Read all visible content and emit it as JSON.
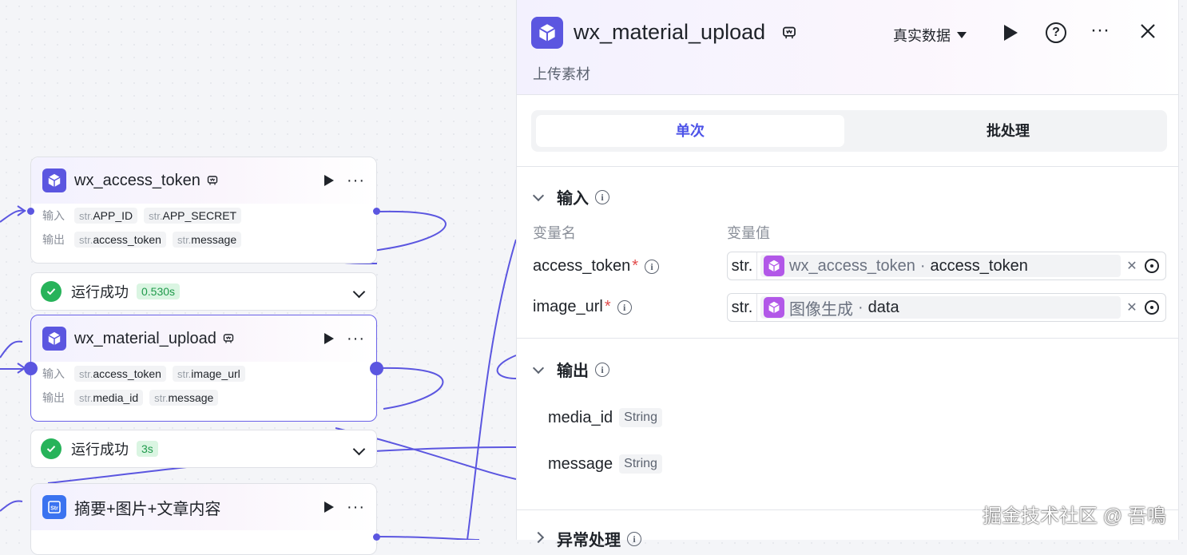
{
  "canvas": {
    "nodes": [
      {
        "title": "wx_access_token",
        "icon": "plugin-cube-icon",
        "inputs_label": "输入",
        "outputs_label": "输出",
        "inputs": [
          {
            "type": "str.",
            "name": "APP_ID"
          },
          {
            "type": "str.",
            "name": "APP_SECRET"
          }
        ],
        "outputs": [
          {
            "type": "str.",
            "name": "access_token"
          },
          {
            "type": "str.",
            "name": "message"
          }
        ],
        "status": {
          "text": "运行成功",
          "time": "0.530s"
        }
      },
      {
        "title": "wx_material_upload",
        "icon": "plugin-cube-icon",
        "inputs_label": "输入",
        "outputs_label": "输出",
        "inputs": [
          {
            "type": "str.",
            "name": "access_token"
          },
          {
            "type": "str.",
            "name": "image_url"
          }
        ],
        "outputs": [
          {
            "type": "str.",
            "name": "media_id"
          },
          {
            "type": "str.",
            "name": "message"
          }
        ],
        "status": {
          "text": "运行成功",
          "time": "3s"
        }
      },
      {
        "title": "摘要+图片+文章内容",
        "icon": "text-str-icon"
      }
    ]
  },
  "panel": {
    "title": "wx_material_upload",
    "subtitle": "上传素材",
    "mode": "真实数据",
    "tabs": [
      {
        "label": "单次"
      },
      {
        "label": "批处理"
      }
    ],
    "input_section": {
      "title": "输入",
      "col_name": "变量名",
      "col_value": "变量值",
      "rows": [
        {
          "name": "access_token",
          "required": "*",
          "type": "str.",
          "ref_node": "wx_access_token",
          "sep": "·",
          "ref_field": "access_token"
        },
        {
          "name": "image_url",
          "required": "*",
          "type": "str.",
          "ref_node": "图像生成",
          "sep": "·",
          "ref_field": "data"
        }
      ]
    },
    "output_section": {
      "title": "输出",
      "rows": [
        {
          "name": "media_id",
          "type": "String"
        },
        {
          "name": "message",
          "type": "String"
        }
      ]
    },
    "error_section": {
      "title": "异常处理"
    }
  },
  "watermark": "掘金技术社区 @ 吾鳴",
  "colors": {
    "accent": "#5b56e0",
    "success": "#27b35a",
    "ref_icon": "#b258e8",
    "wire": "#5b56e0"
  }
}
